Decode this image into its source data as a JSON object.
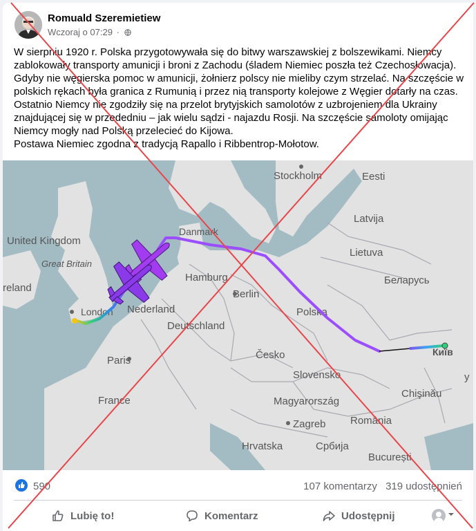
{
  "post": {
    "author": "Romuald Szeremietiew",
    "timestamp": "Wczoraj o 07:29",
    "separator": "·",
    "audience_icon": "globe-icon",
    "text_lines": [
      "W sierpniu 1920 r. Polska przygotowywała się do bitwy warszawskiej z bolszewikami. Niemcy",
      "zablokowały transporty amunicji i broni z Zachodu (śladem Niemiec poszła też Czechosłowacja).",
      "Gdyby nie węgierska pomoc w amunicji, żołnierz polscy nie mieliby czym strzelać. Na szczęście w",
      "polskich rękach była granica z Rumunią i przez nią transporty kolejowe z Węgier dotarły na czas.",
      "Ostatnio Niemcy nie zgodziły się na przelot brytyjskich samolotów z uzbrojeniem dla Ukrainy",
      "znajdującej się w przededniu – jak wielu sądzi - najazdu Rosji. Na szczęście samoloty omijając",
      "Niemcy mogły nad Polską przelecieć do Kijowa.",
      "Postawa Niemiec zgodna z tradycją Rapallo i Ribbentrop-Mołotow."
    ]
  },
  "map": {
    "labels": {
      "stockholm": "Stockholm",
      "eesti": "Eesti",
      "latvija": "Latvija",
      "lietuva": "Lietuva",
      "belarus": "Беларусь",
      "danmark": "Danmark",
      "united_kingdom": "United Kingdom",
      "great_britain": "Great Britain",
      "ireland": "reland",
      "hamburg": "Hamburg",
      "berlin": "Berlin",
      "polska": "Polska",
      "nederland": "Nederland",
      "london": "London",
      "deutschland": "Deutschland",
      "paris": "Paris",
      "cesko": "Česko",
      "kyiv": "Київ",
      "slovensko": "Slovensko",
      "france": "France",
      "chisinau": "Chişinău",
      "magyarorszag": "Magyarország",
      "zagreb": "Zagreb",
      "romania": "România",
      "hrvatska": "Hrvatska",
      "srbija": "Србија",
      "bucuresti": "București",
      "edge_y": "у"
    }
  },
  "reactions": {
    "like_icon": "thumbs-up-icon",
    "count": "590",
    "comments": "107 komentarzy",
    "shares": "319 udostępnień"
  },
  "actions": {
    "like": "Lubię to!",
    "comment": "Komentarz",
    "share": "Udostępnij"
  },
  "colors": {
    "facebook_blue": "#1b74e4",
    "flight_path": "#9b4dff",
    "cross": "#e8454a",
    "sea": "#a3bcc4",
    "land": "#e2e2e2"
  }
}
